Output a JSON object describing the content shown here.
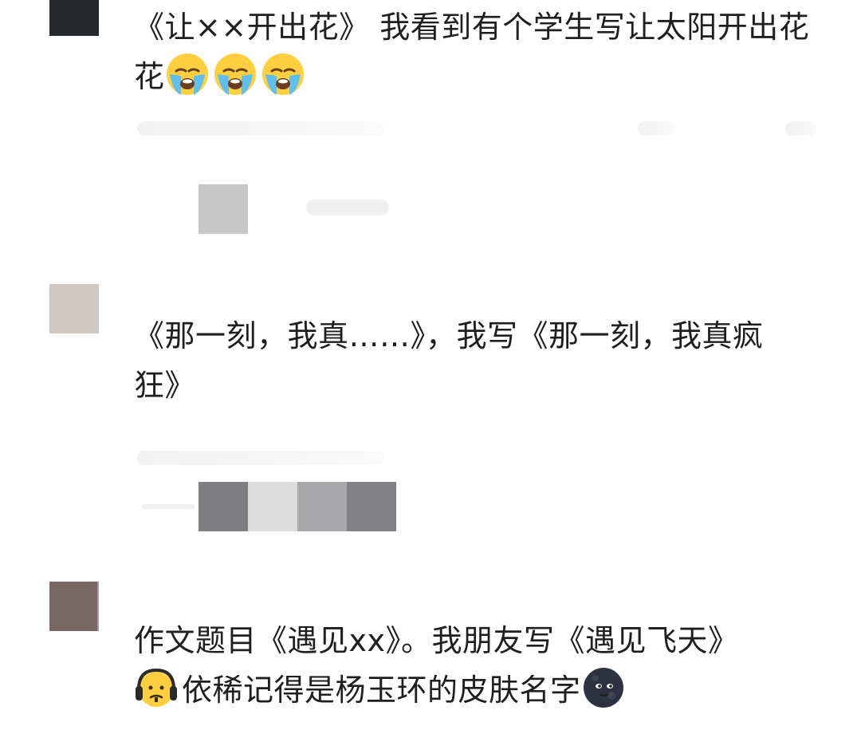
{
  "comments": [
    {
      "avatar_color": "#26292b",
      "text": "《让××开出花》 我看到有个学生写让太阳开出花",
      "emoji_count": 3,
      "emoji_name": "loudly-crying-face"
    },
    {
      "avatar_color": "#d0c8c3",
      "text_line1": "《那一刻，我真……》，我写《那一刻，我真疯",
      "text_line2": "狂》"
    },
    {
      "avatar_color": "#786862",
      "text_line1": "作文题目《遇见xx》。我朋友写《遇见飞天》",
      "text_line2_before": "依稀记得是杨玉环的皮肤名字",
      "emoji_left": "headphones-face",
      "emoji_right": "new-moon-face"
    }
  ],
  "pixelated_blocks": [
    [
      "#c8c8c8"
    ],
    [
      "#7f7f83",
      "#dcdcdc",
      "#a9a9ab",
      "#828286"
    ]
  ]
}
